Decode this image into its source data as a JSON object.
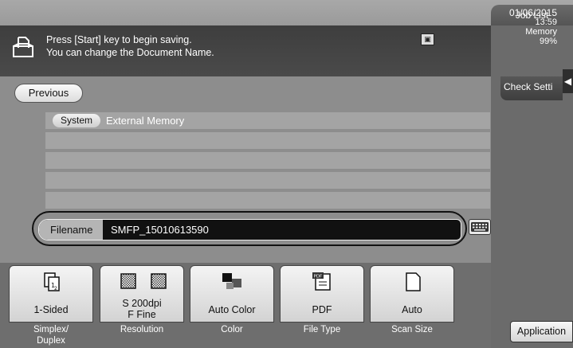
{
  "header": {
    "job_list_label": "Job List"
  },
  "message": {
    "line1": "Press [Start] key to begin saving.",
    "line2": "You can change the Document Name.",
    "usb_label": "USB"
  },
  "status": {
    "date": "01/06/2015",
    "time": "13:59",
    "memory_label": "Memory",
    "memory_value": "99%"
  },
  "side": {
    "check_settings_label": "Check Setti",
    "arrow": "◀"
  },
  "nav": {
    "previous_label": "Previous"
  },
  "location": {
    "system_label": "System",
    "path": "External Memory"
  },
  "filename": {
    "label": "Filename",
    "value": "SMFP_15010613590"
  },
  "toolbar": {
    "buttons": [
      {
        "value": "1-Sided",
        "caption": "Simplex/\nDuplex",
        "icon": "simplex-icon"
      },
      {
        "value": "S 200dpi\nF Fine",
        "caption": "Resolution",
        "icon": "resolution-icon"
      },
      {
        "value": "Auto Color",
        "caption": "Color",
        "icon": "color-icon"
      },
      {
        "value": "PDF",
        "caption": "File Type",
        "icon": "pdf-icon"
      },
      {
        "value": "Auto",
        "caption": "Scan Size",
        "icon": "page-icon"
      }
    ],
    "application_label": "Application"
  },
  "colors": {
    "message_bg": "#3e3e3e",
    "panel_bg": "#8d8d8d",
    "button_bg": "#e8e8e8"
  }
}
